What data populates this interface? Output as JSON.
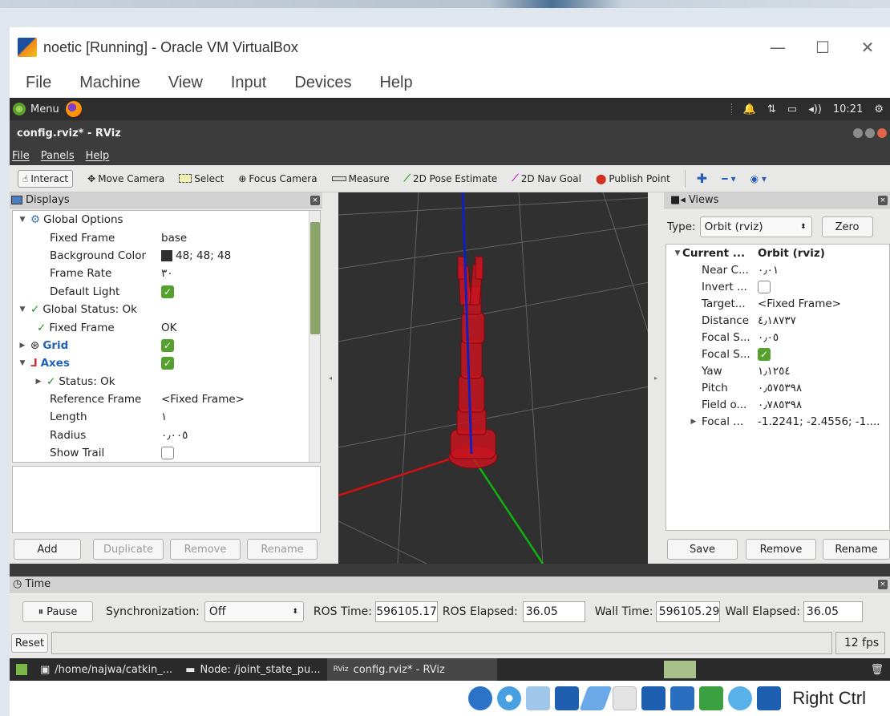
{
  "vbox": {
    "title": "noetic [Running] - Oracle VM VirtualBox",
    "min_glyph": "—",
    "max_glyph": "☐",
    "close_glyph": "✕",
    "menu": [
      "File",
      "Machine",
      "View",
      "Input",
      "Devices",
      "Help"
    ],
    "host_key": "Right Ctrl"
  },
  "guest_panel": {
    "menu_label": "Menu",
    "clock": "10:21"
  },
  "rviz": {
    "window_title": "config.rviz* - RViz",
    "menu": [
      "File",
      "Panels",
      "Help"
    ],
    "tools": [
      "Interact",
      "Move Camera",
      "Select",
      "Focus Camera",
      "Measure",
      "2D Pose Estimate",
      "2D Nav Goal",
      "Publish Point"
    ],
    "displays": {
      "title": "Displays",
      "rows": [
        {
          "name": "Global Options",
          "value": ""
        },
        {
          "name": "Fixed Frame",
          "value": "base"
        },
        {
          "name": "Background Color",
          "value": "48; 48; 48"
        },
        {
          "name": "Frame Rate",
          "value": "٣٠"
        },
        {
          "name": "Default Light",
          "value": ""
        },
        {
          "name": "Global Status: Ok",
          "value": ""
        },
        {
          "name": "Fixed Frame",
          "value": "OK"
        },
        {
          "name": "Grid",
          "value": ""
        },
        {
          "name": "Axes",
          "value": ""
        },
        {
          "name": "Status: Ok",
          "value": ""
        },
        {
          "name": "Reference Frame",
          "value": "<Fixed Frame>"
        },
        {
          "name": "Length",
          "value": "١"
        },
        {
          "name": "Radius",
          "value": "٠٫٠٠٥"
        },
        {
          "name": "Show Trail",
          "value": ""
        }
      ],
      "buttons": {
        "add": "Add",
        "duplicate": "Duplicate",
        "remove": "Remove",
        "rename": "Rename"
      }
    },
    "views": {
      "title": "Views",
      "type_label": "Type:",
      "type_value": "Orbit (rviz)",
      "zero": "Zero",
      "rows": [
        {
          "name": "Current ...",
          "value": "Orbit (rviz)"
        },
        {
          "name": "Near C...",
          "value": "٠٫٠١"
        },
        {
          "name": "Invert ...",
          "value": ""
        },
        {
          "name": "Target...",
          "value": "<Fixed Frame>"
        },
        {
          "name": "Distance",
          "value": "٤٫١٨٧٣٧"
        },
        {
          "name": "Focal S...",
          "value": "٠٫٠٥"
        },
        {
          "name": "Focal S...",
          "value": ""
        },
        {
          "name": "Yaw",
          "value": "١٫١٢٥٤"
        },
        {
          "name": "Pitch",
          "value": "٠٫٥٧٥٣٩٨"
        },
        {
          "name": "Field o...",
          "value": "٠٫٧٨٥٣٩٨"
        },
        {
          "name": "Focal ...",
          "value": "-1.2241; -2.4556; -1...."
        }
      ],
      "buttons": {
        "save": "Save",
        "remove": "Remove",
        "rename": "Rename"
      }
    },
    "time": {
      "title": "Time",
      "pause": "Pause",
      "sync_label": "Synchronization:",
      "sync_value": "Off",
      "ros_time_label": "ROS Time:",
      "ros_time": "596105.17",
      "ros_elapsed_label": "ROS Elapsed:",
      "ros_elapsed": "36.05",
      "wall_time_label": "Wall Time:",
      "wall_time": "596105.29",
      "wall_elapsed_label": "Wall Elapsed:",
      "wall_elapsed": "36.05",
      "reset": "Reset",
      "fps": "12 fps"
    }
  },
  "taskbar": {
    "tasks": [
      "/home/najwa/catkin_...",
      "Node: /joint_state_pu...",
      "config.rviz* - RViz"
    ]
  },
  "colors": {
    "viewport_bg": "#303030",
    "robot": "#c8141e",
    "x_axis": "#d01010",
    "y_axis": "#10b010",
    "z_axis": "#1020c0",
    "check": "#55a02e"
  }
}
